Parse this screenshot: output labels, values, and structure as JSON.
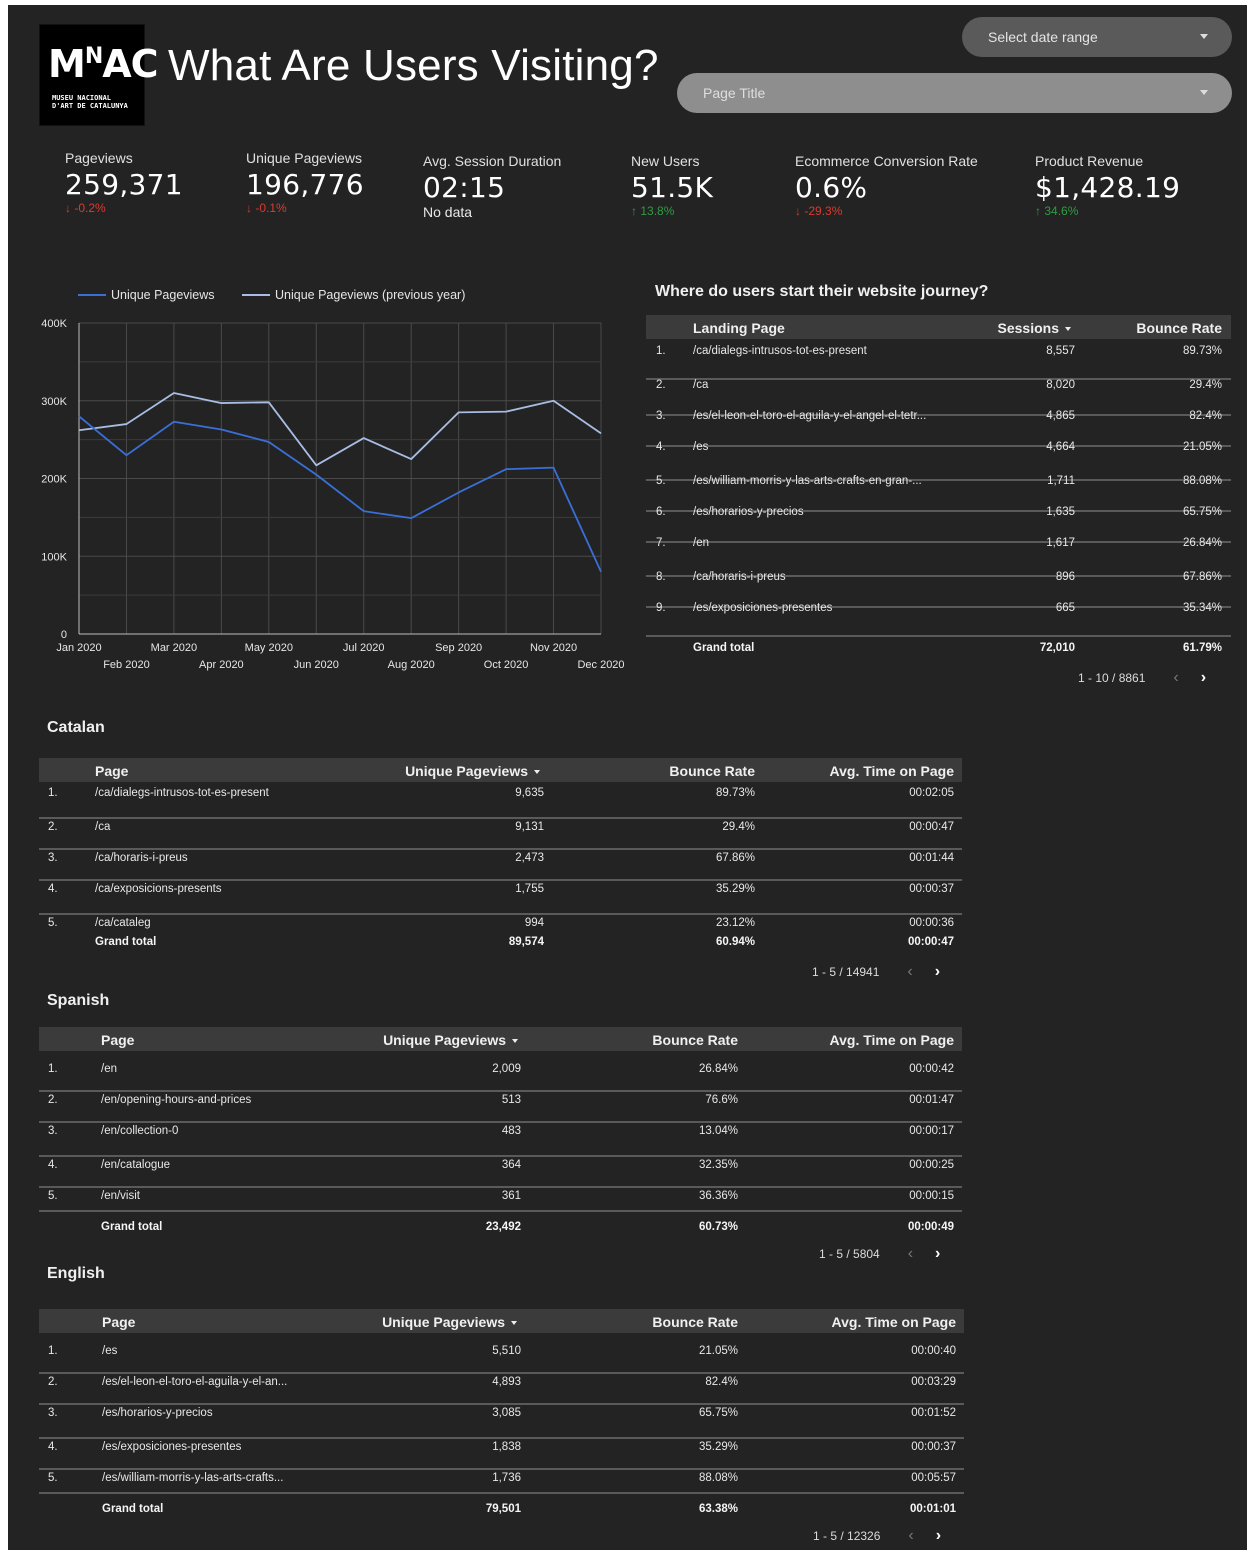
{
  "header": {
    "logo": {
      "letters_main": "MAC",
      "letters_sup": "N",
      "subtitle_line1": "MUSEU NACIONAL",
      "subtitle_line2": "D'ART DE CATALUNYA"
    },
    "title": "What Are Users Visiting?",
    "date_range_placeholder": "Select date range",
    "page_title_placeholder": "Page Title"
  },
  "kpis": [
    {
      "label": "Pageviews",
      "value": "259,371",
      "change": "-0.2%",
      "direction": "down"
    },
    {
      "label": "Unique Pageviews",
      "value": "196,776",
      "change": "-0.1%",
      "direction": "down"
    },
    {
      "label": "Avg. Session Duration",
      "value": "02:15",
      "change": "No data",
      "direction": "none"
    },
    {
      "label": "New Users",
      "value": "51.5K",
      "change": "13.8%",
      "direction": "up"
    },
    {
      "label": "Ecommerce Conversion Rate",
      "value": "0.6%",
      "change": "-29.3%",
      "direction": "down"
    },
    {
      "label": "Product Revenue",
      "value": "$1,428.19",
      "change": "34.6%",
      "direction": "up"
    }
  ],
  "colors": {
    "up": "#2e9c43",
    "down": "#d93b2f",
    "series_current": "#3a6fd8",
    "series_previous": "#a8bde3"
  },
  "chart_data": {
    "type": "line",
    "title": "",
    "x": [
      "Jan 2020",
      "Feb 2020",
      "Mar 2020",
      "Apr 2020",
      "May 2020",
      "Jun 2020",
      "Jul 2020",
      "Aug 2020",
      "Sep 2020",
      "Oct 2020",
      "Nov 2020",
      "Dec 2020"
    ],
    "series": [
      {
        "name": "Unique Pageviews",
        "values": [
          280000,
          230000,
          273000,
          263000,
          247000,
          205000,
          158000,
          149000,
          182000,
          212000,
          214000,
          80000
        ]
      },
      {
        "name": "Unique Pageviews (previous year)",
        "values": [
          262000,
          270000,
          310000,
          297000,
          298000,
          217000,
          252000,
          225000,
          285000,
          286000,
          300000,
          258000
        ]
      }
    ],
    "yticks": [
      "0",
      "100K",
      "200K",
      "300K",
      "400K"
    ],
    "ylim": [
      0,
      400000
    ],
    "grid": true,
    "legend": "top-left"
  },
  "landing": {
    "title": "Where do users start their website journey?",
    "headers": [
      "Landing Page",
      "Sessions",
      "Bounce Rate"
    ],
    "rows": [
      [
        "1.",
        "/ca/dialegs-intrusos-tot-es-present",
        "8,557",
        "89.73%"
      ],
      [
        "2.",
        "/ca",
        "8,020",
        "29.4%"
      ],
      [
        "3.",
        "/es/el-leon-el-toro-el-aguila-y-el-angel-el-tetr...",
        "4,865",
        "82.4%"
      ],
      [
        "4.",
        "/es",
        "4,664",
        "21.05%"
      ],
      [
        "5.",
        "/es/william-morris-y-las-arts-crafts-en-gran-...",
        "1,711",
        "88.08%"
      ],
      [
        "6.",
        "/es/horarios-y-precios",
        "1,635",
        "65.75%"
      ],
      [
        "7.",
        "/en",
        "1,617",
        "26.84%"
      ],
      [
        "8.",
        "/ca/horaris-i-preus",
        "896",
        "67.86%"
      ],
      [
        "9.",
        "/es/exposiciones-presentes",
        "665",
        "35.34%"
      ]
    ],
    "total": [
      "Grand total",
      "72,010",
      "61.79%"
    ],
    "pager": "1 - 10 / 8861"
  },
  "tables": [
    {
      "title": "Catalan",
      "headers": [
        "Page",
        "Unique Pageviews",
        "Bounce Rate",
        "Avg. Time on Page"
      ],
      "rows": [
        [
          "1.",
          "/ca/dialegs-intrusos-tot-es-present",
          "9,635",
          "89.73%",
          "00:02:05"
        ],
        [
          "2.",
          "/ca",
          "9,131",
          "29.4%",
          "00:00:47"
        ],
        [
          "3.",
          "/ca/horaris-i-preus",
          "2,473",
          "67.86%",
          "00:01:44"
        ],
        [
          "4.",
          "/ca/exposicions-presents",
          "1,755",
          "35.29%",
          "00:00:37"
        ],
        [
          "5.",
          "/ca/cataleg",
          "994",
          "23.12%",
          "00:00:36"
        ]
      ],
      "total": [
        "Grand total",
        "89,574",
        "60.94%",
        "00:00:47"
      ],
      "pager": "1 - 5 / 14941"
    },
    {
      "title": "Spanish",
      "headers": [
        "Page",
        "Unique Pageviews",
        "Bounce Rate",
        "Avg. Time on Page"
      ],
      "rows": [
        [
          "1.",
          "/en",
          "2,009",
          "26.84%",
          "00:00:42"
        ],
        [
          "2.",
          "/en/opening-hours-and-prices",
          "513",
          "76.6%",
          "00:01:47"
        ],
        [
          "3.",
          "/en/collection-0",
          "483",
          "13.04%",
          "00:00:17"
        ],
        [
          "4.",
          "/en/catalogue",
          "364",
          "32.35%",
          "00:00:25"
        ],
        [
          "5.",
          "/en/visit",
          "361",
          "36.36%",
          "00:00:15"
        ]
      ],
      "total": [
        "Grand total",
        "23,492",
        "60.73%",
        "00:00:49"
      ],
      "pager": "1 - 5 / 5804"
    },
    {
      "title": "English",
      "headers": [
        "Page",
        "Unique Pageviews",
        "Bounce Rate",
        "Avg. Time on Page"
      ],
      "rows": [
        [
          "1.",
          "/es",
          "5,510",
          "21.05%",
          "00:00:40"
        ],
        [
          "2.",
          "/es/el-leon-el-toro-el-aguila-y-el-an...",
          "4,893",
          "82.4%",
          "00:03:29"
        ],
        [
          "3.",
          "/es/horarios-y-precios",
          "3,085",
          "65.75%",
          "00:01:52"
        ],
        [
          "4.",
          "/es/exposiciones-presentes",
          "1,838",
          "35.29%",
          "00:00:37"
        ],
        [
          "5.",
          "/es/william-morris-y-las-arts-crafts...",
          "1,736",
          "88.08%",
          "00:05:57"
        ]
      ],
      "total": [
        "Grand total",
        "79,501",
        "63.38%",
        "00:01:01"
      ],
      "pager": "1 - 5 / 12326"
    }
  ],
  "icons": {
    "sort": "sort-desc-icon",
    "prev": "chevron-left-icon",
    "next": "chevron-right-icon",
    "up": "arrow-up-icon",
    "down": "arrow-down-icon"
  }
}
